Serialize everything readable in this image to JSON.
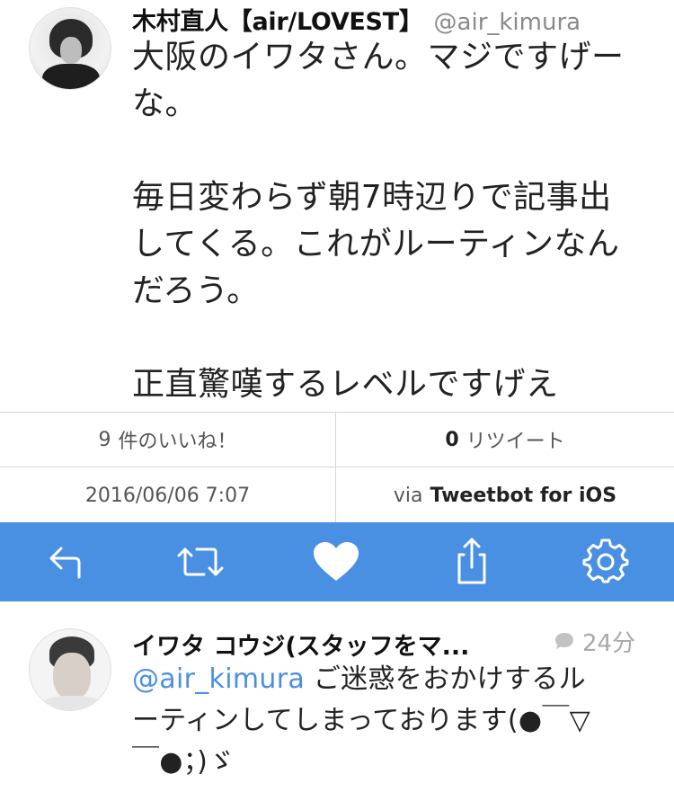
{
  "tweet": {
    "display_name": "木村直人【air/LOVEST】",
    "handle": "@air_kimura",
    "lines": [
      "大阪のイワタさん。マジですげー",
      "な。",
      "",
      "毎日変わらず朝7時辺りで記事出",
      "してくる。これがルーティンなん",
      "だろう。",
      "",
      "正直驚嘆するレベルですげえ"
    ]
  },
  "stats": {
    "likes_count": "9",
    "likes_label": "件のいいね！",
    "retweets_count": "0",
    "retweets_label": "リツイート",
    "date": "2016/06/06 7:07",
    "via_prefix": "via",
    "via_app": "Tweetbot for iOS"
  },
  "actions": {
    "bar_color": "#4a90e2",
    "icons": [
      "reply-icon",
      "retweet-icon",
      "heart-icon",
      "share-icon",
      "gear-icon"
    ]
  },
  "reply": {
    "display_name": "イワタ コウジ(スタッフをマ...",
    "time": "24分",
    "mention": "@air_kimura",
    "text_first": " ご迷惑をおかけするル",
    "text_second": "ーティンしてしまっております(●￣▽",
    "text_third": "￣●；)ゞ"
  }
}
